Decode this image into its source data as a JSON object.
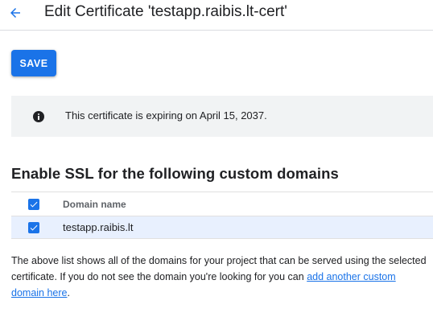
{
  "header": {
    "title": "Edit Certificate 'testapp.raibis.lt-cert'",
    "back_icon": "arrow-back-icon"
  },
  "toolbar": {
    "save_label": "SAVE"
  },
  "info": {
    "icon": "info-icon",
    "message": "This certificate is expiring on April 15, 2037."
  },
  "section": {
    "title": "Enable SSL for the following custom domains"
  },
  "table": {
    "column_header": "Domain name",
    "header_checked": true,
    "rows": [
      {
        "domain": "testapp.raibis.lt",
        "checked": true
      }
    ]
  },
  "description": {
    "text": "The above list shows all of the domains for your project that can be served using the selected certificate. If you do not see the domain you're looking for you can ",
    "link_text": "add another custom domain here",
    "suffix": "."
  },
  "colors": {
    "accent": "#1a73e8",
    "info_bg": "#f1f3f4",
    "row_selected_bg": "#e8f0fe"
  }
}
